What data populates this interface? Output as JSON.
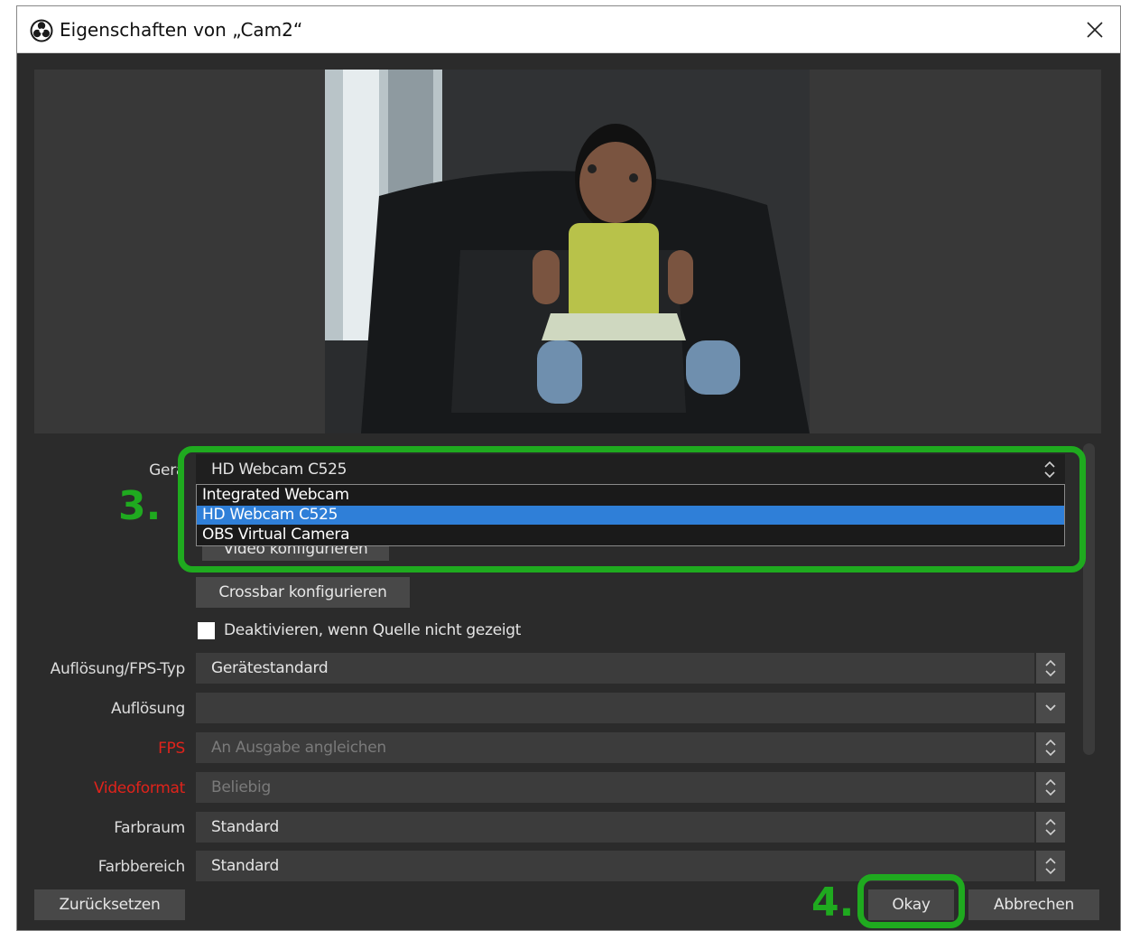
{
  "window": {
    "title": "Eigenschaften von „Cam2“"
  },
  "preview": {
    "description_icon": "webcam-preview"
  },
  "fields": {
    "device": {
      "label": "Gerä",
      "value": "HD Webcam C525"
    },
    "configure_video_label": "Video konfigurieren",
    "configure_crossbar_label": "Crossbar konfigurieren",
    "deactivate_checkbox_label": "Deaktivieren, wenn Quelle nicht gezeigt",
    "res_fps_type": {
      "label": "Auflösung/FPS-Typ",
      "value": "Gerätestandard"
    },
    "resolution": {
      "label": "Auflösung",
      "value": ""
    },
    "fps": {
      "label": "FPS",
      "value": "An Ausgabe angleichen"
    },
    "video_format": {
      "label": "Videoformat",
      "value": "Beliebig"
    },
    "color_space": {
      "label": "Farbraum",
      "value": "Standard"
    },
    "color_range": {
      "label": "Farbbereich",
      "value": "Standard"
    }
  },
  "device_dropdown": {
    "options": [
      "Integrated Webcam",
      "HD Webcam C525",
      "OBS Virtual Camera"
    ],
    "selected": "HD Webcam C525"
  },
  "footer": {
    "reset_label": "Zurücksetzen",
    "ok_label": "Okay",
    "cancel_label": "Abbrechen"
  },
  "annotations": {
    "step3": "3.",
    "step4": "4."
  },
  "colors": {
    "highlight": "#1faa1f",
    "selection": "#2f7fd8",
    "error_label": "#e0231b"
  }
}
